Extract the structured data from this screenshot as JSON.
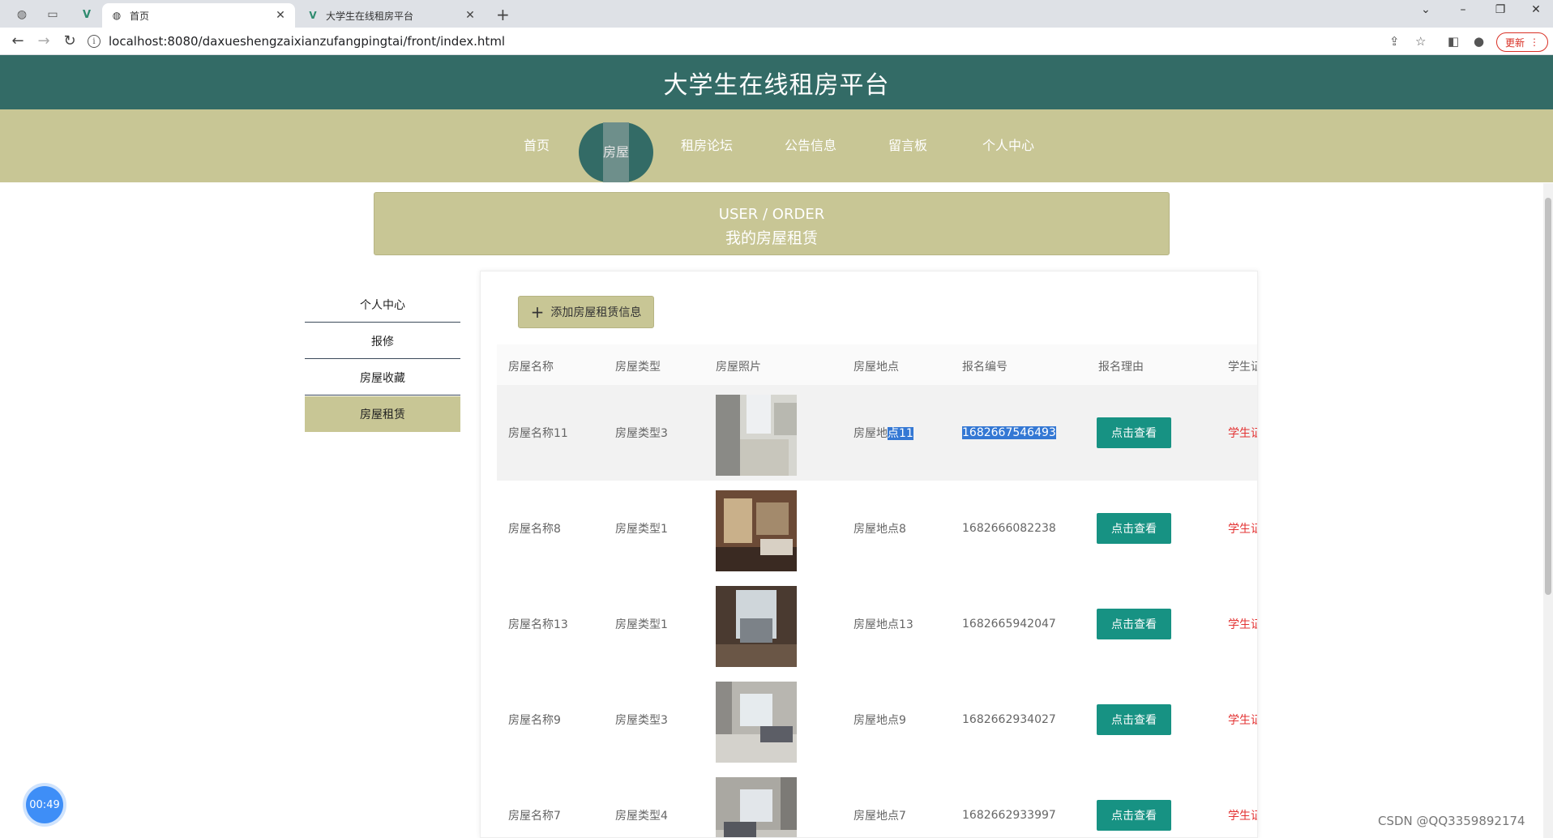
{
  "browser": {
    "tabs": [
      {
        "title": "首页",
        "icon": "globe-icon",
        "active": true
      },
      {
        "title": "大学生在线租房平台",
        "icon": "vue-icon",
        "active": false
      }
    ],
    "url": "localhost:8080/daxueshengzaixianzufangpingtai/front/index.html",
    "update_label": "更新"
  },
  "site": {
    "title": "大学生在线租房平台",
    "nav": [
      "首页",
      "房屋",
      "租房论坛",
      "公告信息",
      "留言板",
      "个人中心"
    ],
    "active_nav": "房屋"
  },
  "banner": {
    "en": "USER / ORDER",
    "cn": "我的房屋租赁"
  },
  "sidebar": {
    "items": [
      "个人中心",
      "报修",
      "房屋收藏",
      "房屋租赁"
    ],
    "active": "房屋租赁"
  },
  "main": {
    "add_label": "添加房屋租赁信息",
    "columns": [
      "房屋名称",
      "房屋类型",
      "房屋照片",
      "房屋地点",
      "报名编号",
      "报名理由",
      "学生证"
    ],
    "view_label": "点击查看",
    "rows": [
      {
        "name": "房屋名称11",
        "type": "房屋类型3",
        "loc_prefix": "房屋地",
        "loc_sel": "点11",
        "code": "1682667546493",
        "stu": "学生证"
      },
      {
        "name": "房屋名称8",
        "type": "房屋类型1",
        "loc_prefix": "房屋地点8",
        "loc_sel": "",
        "code": "1682666082238",
        "stu": "学生证"
      },
      {
        "name": "房屋名称13",
        "type": "房屋类型1",
        "loc_prefix": "房屋地点13",
        "loc_sel": "",
        "code": "1682665942047",
        "stu": "学生证"
      },
      {
        "name": "房屋名称9",
        "type": "房屋类型3",
        "loc_prefix": "房屋地点9",
        "loc_sel": "",
        "code": "1682662934027",
        "stu": "学生证"
      },
      {
        "name": "房屋名称7",
        "type": "房屋类型4",
        "loc_prefix": "房屋地点7",
        "loc_sel": "",
        "code": "1682662933997",
        "stu": "学生证"
      }
    ]
  },
  "overlay": {
    "timer": "00:49",
    "watermark": "CSDN @QQ3359892174"
  },
  "colors": {
    "header": "#336b66",
    "nav": "#c8c695",
    "button": "#179283",
    "link_red": "#e33333"
  }
}
